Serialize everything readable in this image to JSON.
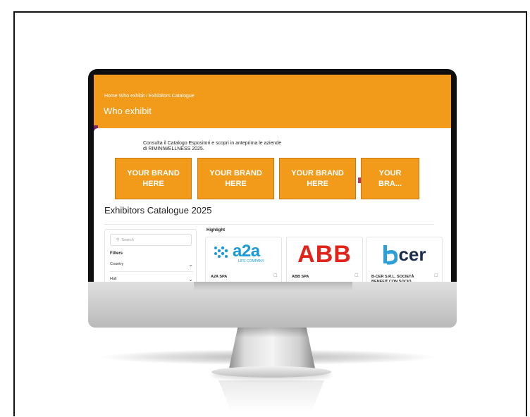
{
  "breadcrumb": {
    "items": [
      "Home",
      "Who exhibit",
      "Exhibitors Catalogue"
    ],
    "separator": "/"
  },
  "hero": {
    "title": "Who exhibit",
    "background_color": "#f29a1a"
  },
  "intro": {
    "line1": "Consulta il Catalogo Espositori e scopri in anteprima le aziende",
    "line2": "di RIMINIWELLNESS 2025."
  },
  "brand_banners": [
    {
      "line1": "YOUR BRAND",
      "line2": "HERE"
    },
    {
      "line1": "YOUR BRAND",
      "line2": "HERE"
    },
    {
      "line1": "YOUR BRAND",
      "line2": "HERE"
    },
    {
      "line1": "YOUR",
      "line2": "BRA..."
    }
  ],
  "catalogue": {
    "title": "Exhibitors Catalogue 2025",
    "search_placeholder": "Search",
    "filters_label": "Filters",
    "filter_rows": [
      "Country",
      "Hall"
    ],
    "highlight_label": "Highlight",
    "exhibitors": [
      {
        "name": "A2A SPA",
        "logo_text": "a2a",
        "logo_subtext": "LIFE COMPANY",
        "logo_color": "#1a9ad6"
      },
      {
        "name": "ABB SPA",
        "logo_text": "ABB",
        "logo_color": "#e2231a"
      },
      {
        "name": "B-CER S.R.L. SOCIETÀ BENEFIT CON SOCIO",
        "logo_text": "cer",
        "logo_color": "#1a2b4c",
        "accent_color": "#2a9fd8"
      }
    ]
  },
  "icons": {
    "search": "search-icon",
    "chevron": "chevron-down-icon",
    "bookmark": "bookmark-icon"
  }
}
